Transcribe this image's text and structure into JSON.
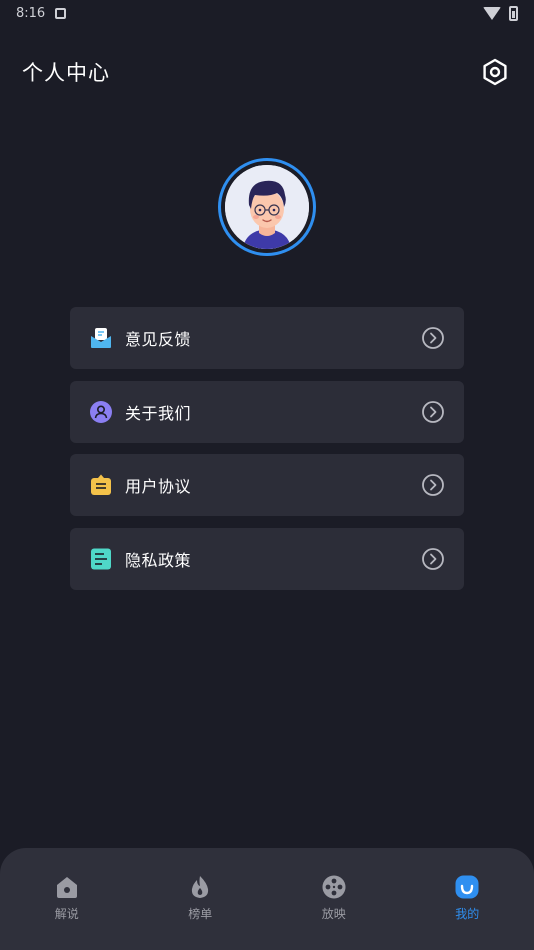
{
  "status_bar": {
    "time": "8:16"
  },
  "header": {
    "title": "个人中心",
    "settings_icon": "settings-icon"
  },
  "profile": {
    "avatar_ring_color": "#2f8ff0"
  },
  "menu": {
    "items": [
      {
        "label": "意见反馈",
        "icon": "feedback-icon",
        "icon_color": "#4fb6f0"
      },
      {
        "label": "关于我们",
        "icon": "user-icon",
        "icon_color": "#8b7ff2"
      },
      {
        "label": "用户协议",
        "icon": "agreement-icon",
        "icon_color": "#f4c24a"
      },
      {
        "label": "隐私政策",
        "icon": "privacy-icon",
        "icon_color": "#4fd8c8"
      }
    ]
  },
  "tabbar": {
    "tabs": [
      {
        "label": "解说",
        "icon": "home-icon",
        "active": false
      },
      {
        "label": "榜单",
        "icon": "flame-icon",
        "active": false
      },
      {
        "label": "放映",
        "icon": "film-reel-icon",
        "active": false
      },
      {
        "label": "我的",
        "icon": "profile-icon",
        "active": true
      }
    ],
    "active_color": "#2f8ff0"
  }
}
